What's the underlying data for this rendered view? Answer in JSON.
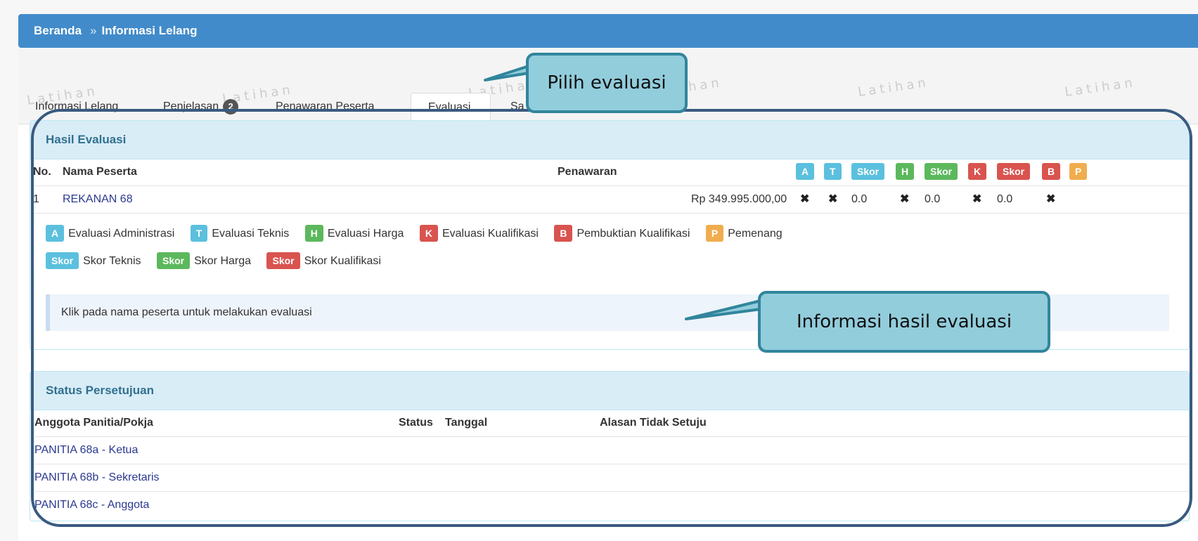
{
  "breadcrumb": {
    "home": "Beranda",
    "separator": "»",
    "current": "Informasi Lelang"
  },
  "tabs": [
    {
      "label": "Informasi Lelang"
    },
    {
      "label": "Penjelasan",
      "badge": "2"
    },
    {
      "label": "Penawaran Peserta"
    },
    {
      "label": "Evaluasi",
      "active": true
    },
    {
      "label": "Sa"
    }
  ],
  "watermark_text": "Latihan",
  "hasil_evaluasi": {
    "title": "Hasil Evaluasi",
    "headers": {
      "no": "No.",
      "nama": "Nama Peserta",
      "penawaran": "Penawaran",
      "a": "A",
      "t": "T",
      "skor_t": "Skor",
      "h": "H",
      "skor_h": "Skor",
      "k": "K",
      "skor_k": "Skor",
      "b": "B",
      "p": "P"
    },
    "rows": [
      {
        "no": "1",
        "nama": "REKANAN 68",
        "penawaran": "Rp 349.995.000,00",
        "a": "✖",
        "t": "✖",
        "skor_t": "0.0",
        "h": "✖",
        "skor_h": "0.0",
        "k": "✖",
        "skor_k": "0.0",
        "b": "✖"
      }
    ],
    "legend": [
      {
        "code": "A",
        "text": "Evaluasi Administrasi",
        "color": "#5bc0de"
      },
      {
        "code": "T",
        "text": "Evaluasi Teknis",
        "color": "#5bc0de"
      },
      {
        "code": "H",
        "text": "Evaluasi Harga",
        "color": "#5cb85c"
      },
      {
        "code": "K",
        "text": "Evaluasi Kualifikasi",
        "color": "#d9534f"
      },
      {
        "code": "B",
        "text": "Pembuktian Kualifikasi",
        "color": "#d9534f"
      },
      {
        "code": "P",
        "text": "Pemenang",
        "color": "#f0ad4e"
      }
    ],
    "legend_skor": [
      {
        "code": "Skor",
        "text": "Skor Teknis",
        "color": "#5bc0de"
      },
      {
        "code": "Skor",
        "text": "Skor Harga",
        "color": "#5cb85c"
      },
      {
        "code": "Skor",
        "text": "Skor Kualifikasi",
        "color": "#d9534f"
      }
    ],
    "hint": "Klik pada nama peserta untuk melakukan evaluasi"
  },
  "status_persetujuan": {
    "title": "Status Persetujuan",
    "headers": {
      "anggota": "Anggota Panitia/Pokja",
      "status": "Status",
      "tanggal": "Tanggal",
      "alasan": "Alasan Tidak Setuju"
    },
    "rows": [
      {
        "anggota": "PANITIA 68a - Ketua"
      },
      {
        "anggota": "PANITIA 68b - Sekretaris"
      },
      {
        "anggota": "PANITIA 68c - Anggota"
      }
    ]
  },
  "callouts": {
    "pilih": "Pilih evaluasi",
    "info": "Informasi hasil evaluasi"
  }
}
